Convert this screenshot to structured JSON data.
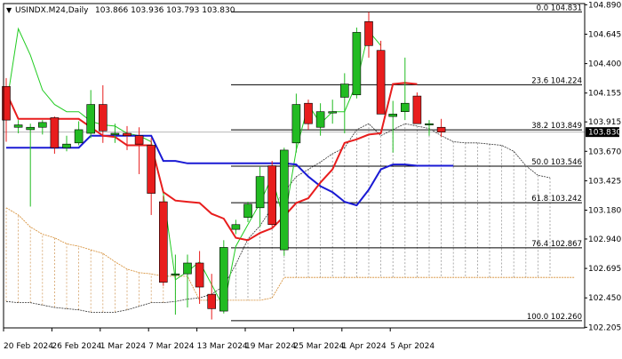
{
  "header": {
    "symbol": "USINDX.M24,Daily",
    "ohlc": "103.866 103.936 103.793 103.830",
    "arrow": "▼"
  },
  "colors": {
    "bull": "#22bb22",
    "bear": "#e81d1d",
    "tenkan": "#e81d1d",
    "kijun": "#1a1ad4",
    "chikou": "#22cc22",
    "spanB": "#d4892c",
    "spanA": "#333333",
    "grid": "#c8c8c8",
    "axis": "#000000",
    "fib": "#000000",
    "currentPriceBg": "#000000",
    "currentPriceLine": "#b8b8b8"
  },
  "chart_data": {
    "type": "candlestick",
    "title": "USINDX.M24,Daily",
    "ylim": [
      102.2,
      104.9
    ],
    "y_ticks": [
      "104.890",
      "104.645",
      "104.400",
      "104.155",
      "103.915",
      "103.670",
      "103.425",
      "103.180",
      "102.940",
      "102.695",
      "102.450",
      "102.205"
    ],
    "x_labels": [
      {
        "bar": 0,
        "label": "20 Feb 2024"
      },
      {
        "bar": 4,
        "label": "26 Feb 2024"
      },
      {
        "bar": 8,
        "label": "1 Mar 2024"
      },
      {
        "bar": 12,
        "label": "7 Mar 2024"
      },
      {
        "bar": 16,
        "label": "13 Mar 2024"
      },
      {
        "bar": 20,
        "label": "19 Mar 2024"
      },
      {
        "bar": 24,
        "label": "25 Mar 2024"
      },
      {
        "bar": 28,
        "label": "1 Apr 2024"
      },
      {
        "bar": 32,
        "label": "5 Apr 2024"
      }
    ],
    "candles": [
      {
        "o": 104.21,
        "h": 104.28,
        "l": 103.75,
        "c": 103.93
      },
      {
        "o": 103.87,
        "h": 103.93,
        "l": 103.82,
        "c": 103.89
      },
      {
        "o": 103.85,
        "h": 103.9,
        "l": 103.21,
        "c": 103.87
      },
      {
        "o": 103.87,
        "h": 103.93,
        "l": 103.81,
        "c": 103.91
      },
      {
        "o": 103.95,
        "h": 103.96,
        "l": 103.65,
        "c": 103.7
      },
      {
        "o": 103.7,
        "h": 103.8,
        "l": 103.67,
        "c": 103.73
      },
      {
        "o": 103.74,
        "h": 103.92,
        "l": 103.72,
        "c": 103.85
      },
      {
        "o": 103.82,
        "h": 104.18,
        "l": 103.78,
        "c": 104.06
      },
      {
        "o": 104.06,
        "h": 104.22,
        "l": 103.74,
        "c": 103.84
      },
      {
        "o": 103.82,
        "h": 103.9,
        "l": 103.74,
        "c": 103.82
      },
      {
        "o": 103.82,
        "h": 103.88,
        "l": 103.68,
        "c": 103.8
      },
      {
        "o": 103.8,
        "h": 103.87,
        "l": 103.48,
        "c": 103.73
      },
      {
        "o": 103.72,
        "h": 103.78,
        "l": 103.14,
        "c": 103.32
      },
      {
        "o": 103.25,
        "h": 103.3,
        "l": 102.55,
        "c": 102.58
      },
      {
        "o": 102.65,
        "h": 102.81,
        "l": 102.31,
        "c": 102.65
      },
      {
        "o": 102.65,
        "h": 102.81,
        "l": 102.37,
        "c": 102.74
      },
      {
        "o": 102.74,
        "h": 102.84,
        "l": 102.4,
        "c": 102.54
      },
      {
        "o": 102.48,
        "h": 102.65,
        "l": 102.27,
        "c": 102.36
      },
      {
        "o": 102.34,
        "h": 102.93,
        "l": 102.32,
        "c": 102.87
      },
      {
        "o": 103.02,
        "h": 103.1,
        "l": 102.98,
        "c": 103.06
      },
      {
        "o": 103.12,
        "h": 103.25,
        "l": 103.08,
        "c": 103.23
      },
      {
        "o": 103.2,
        "h": 103.54,
        "l": 103.04,
        "c": 103.46
      },
      {
        "o": 103.55,
        "h": 103.59,
        "l": 103.04,
        "c": 103.06
      },
      {
        "o": 102.85,
        "h": 103.7,
        "l": 102.8,
        "c": 103.68
      },
      {
        "o": 103.74,
        "h": 104.15,
        "l": 103.66,
        "c": 104.06
      },
      {
        "o": 104.07,
        "h": 104.1,
        "l": 103.85,
        "c": 103.9
      },
      {
        "o": 103.87,
        "h": 104.07,
        "l": 103.8,
        "c": 104.0
      },
      {
        "o": 104.0,
        "h": 104.1,
        "l": 103.9,
        "c": 104.0
      },
      {
        "o": 104.12,
        "h": 104.32,
        "l": 103.82,
        "c": 104.23
      },
      {
        "o": 104.14,
        "h": 104.7,
        "l": 104.11,
        "c": 104.66
      },
      {
        "o": 104.75,
        "h": 104.83,
        "l": 104.45,
        "c": 104.55
      },
      {
        "o": 104.51,
        "h": 104.59,
        "l": 103.98,
        "c": 103.98
      },
      {
        "o": 103.96,
        "h": 104.09,
        "l": 103.66,
        "c": 103.98
      },
      {
        "o": 104.0,
        "h": 104.45,
        "l": 103.93,
        "c": 104.07
      },
      {
        "o": 104.13,
        "h": 104.16,
        "l": 103.9,
        "c": 103.9
      },
      {
        "o": 103.89,
        "h": 103.93,
        "l": 103.8,
        "c": 103.9
      },
      {
        "o": 103.87,
        "h": 103.94,
        "l": 103.79,
        "c": 103.83
      }
    ],
    "lines": {
      "tenkan": [
        104.16,
        103.94,
        103.94,
        103.94,
        103.94,
        103.94,
        103.94,
        103.87,
        103.8,
        103.79,
        103.72,
        103.72,
        103.72,
        103.33,
        103.26,
        103.25,
        103.24,
        103.15,
        103.11,
        102.95,
        102.93,
        102.99,
        103.03,
        103.13,
        103.24,
        103.28,
        103.41,
        103.52,
        103.74,
        103.77,
        103.81,
        103.82,
        104.23,
        104.24,
        104.23
      ],
      "kijun": [
        103.7,
        103.7,
        103.7,
        103.7,
        103.7,
        103.7,
        103.7,
        103.8,
        103.8,
        103.8,
        103.8,
        103.8,
        103.8,
        103.59,
        103.59,
        103.57,
        103.57,
        103.57,
        103.57,
        103.57,
        103.57,
        103.57,
        103.57,
        103.57,
        103.56,
        103.46,
        103.38,
        103.33,
        103.25,
        103.22,
        103.35,
        103.52,
        103.56,
        103.56,
        103.55,
        103.55,
        103.55,
        103.55
      ],
      "chikou": [
        104.04,
        104.69,
        104.47,
        104.18,
        104.06,
        104.0,
        104.0,
        103.92,
        103.89,
        103.88,
        103.82,
        103.8,
        103.75,
        103.32,
        102.6,
        102.67,
        102.75,
        102.56,
        102.37,
        102.88,
        103.06,
        103.24,
        103.46,
        103.08,
        103.68,
        104.06,
        103.9,
        104.0,
        104.0,
        104.24,
        104.67,
        104.55
      ],
      "chikou_start": 0,
      "spanB": [
        103.6,
        103.4,
        103.2,
        103.14,
        103.04,
        102.98,
        102.95,
        102.9,
        102.88,
        102.85,
        102.82,
        102.75,
        102.69,
        102.66,
        102.65,
        102.63,
        102.63,
        102.63,
        102.43,
        102.43,
        102.43,
        102.43,
        102.43,
        102.43,
        102.45,
        102.62,
        102.62,
        102.62,
        102.62,
        102.62,
        102.62,
        102.62,
        102.62,
        102.62,
        102.62,
        102.62,
        102.62,
        102.62,
        102.62,
        102.62,
        102.62,
        102.62,
        102.62,
        102.62,
        102.62,
        102.62,
        102.62,
        102.62,
        102.62,
        102.62
      ],
      "spanA": [
        102.94,
        102.44,
        102.42,
        102.41,
        102.41,
        102.39,
        102.37,
        102.36,
        102.35,
        102.33,
        102.33,
        102.33,
        102.35,
        102.38,
        102.41,
        102.41,
        102.42,
        102.44,
        102.45,
        102.48,
        102.55,
        102.73,
        102.94,
        103.05,
        103.2,
        103.33,
        103.46,
        103.52,
        103.58,
        103.65,
        103.7,
        103.85,
        103.9,
        103.8,
        103.85,
        103.9,
        103.88,
        103.86,
        103.8,
        103.75,
        103.74,
        103.74,
        103.73,
        103.72,
        103.67,
        103.55,
        103.47,
        103.45
      ],
      "cloud_shift_start": -2
    },
    "fib_levels": [
      {
        "label": "0.0 104.831",
        "value": 104.831
      },
      {
        "label": "23.6 104.224",
        "value": 104.224
      },
      {
        "label": "38.2 103.849",
        "value": 103.849
      },
      {
        "label": "50.0 103.546",
        "value": 103.546
      },
      {
        "label": "61.8 103.242",
        "value": 103.242
      },
      {
        "label": "76.4 102.867",
        "value": 102.867
      },
      {
        "label": "100.0 102.260",
        "value": 102.26
      }
    ],
    "current_price": {
      "value": 103.83,
      "label": "103.830"
    }
  }
}
